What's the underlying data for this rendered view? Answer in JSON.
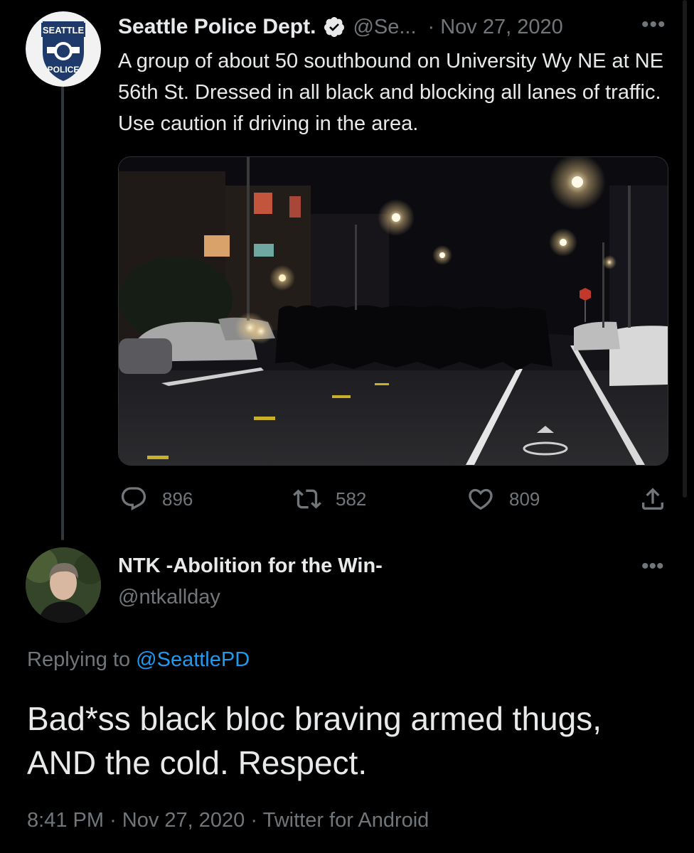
{
  "tweet": {
    "author_name": "Seattle Police Dept.",
    "handle": "@Se...",
    "separator": "·",
    "date": "Nov 27, 2020",
    "text": "A group of about 50 southbound on University Wy NE at NE 56th St. Dressed in all black and blocking all lanes of traffic. Use caution if driving in the area.",
    "avatar_text_top": "SEATTLE",
    "avatar_text_bottom": "POLICE",
    "more": "•••",
    "stats": {
      "replies": "896",
      "retweets": "582",
      "likes": "809"
    }
  },
  "reply": {
    "author_name": "NTK -Abolition for the Win-",
    "handle": "@ntkallday",
    "more": "•••",
    "replying_prefix": "Replying to ",
    "replying_handle": "@SeattlePD",
    "text": "Bad*ss black bloc braving armed thugs, AND the cold. Respect.",
    "time": "8:41 PM",
    "separator": "·",
    "date": "Nov 27, 2020",
    "source": "Twitter for Android"
  },
  "colors": {
    "background": "#000000",
    "text": "#e7e9ea",
    "muted": "#71767b",
    "link": "#1d9bf0"
  },
  "icons": [
    "verified-badge-icon",
    "reply-icon",
    "retweet-icon",
    "like-icon",
    "share-icon",
    "more-icon"
  ]
}
